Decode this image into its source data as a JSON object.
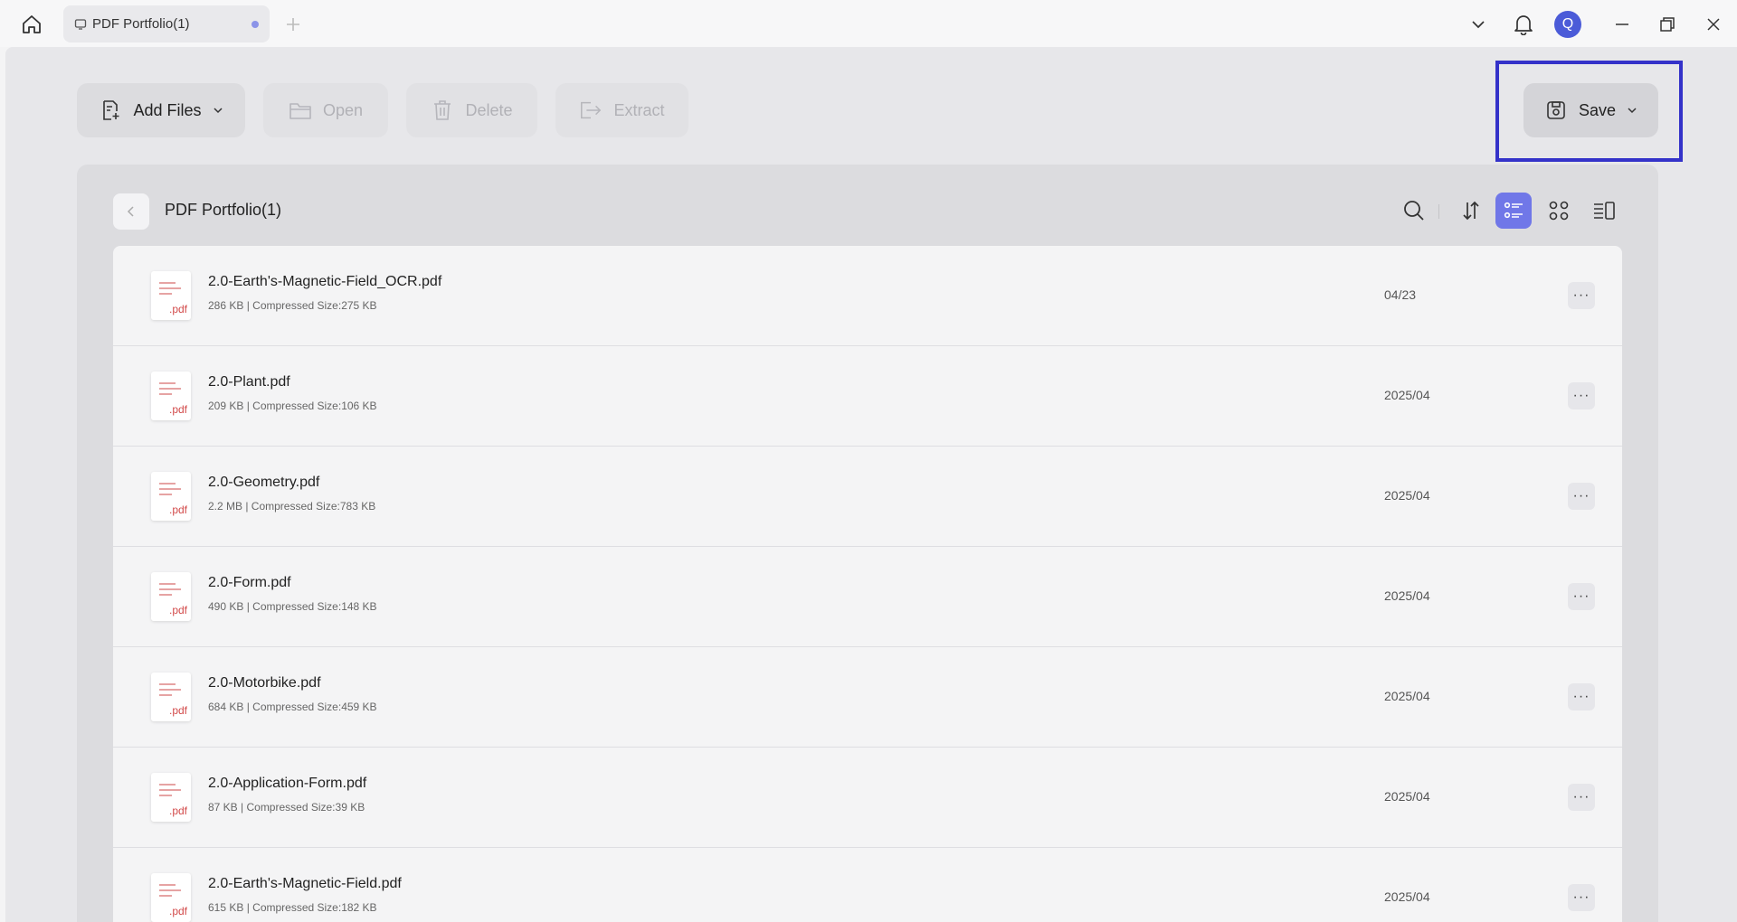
{
  "titlebar": {
    "tab_label": "PDF Portfolio(1)",
    "avatar_letter": "Q"
  },
  "toolbar": {
    "add_files_label": "Add Files",
    "open_label": "Open",
    "delete_label": "Delete",
    "extract_label": "Extract",
    "save_label": "Save"
  },
  "panel": {
    "title": "PDF Portfolio(1)"
  },
  "files": [
    {
      "name": "2.0-Earth's-Magnetic-Field_OCR.pdf",
      "meta": "286 KB | Compressed Size:275 KB",
      "date": "04/23",
      "ext": ".pdf"
    },
    {
      "name": "2.0-Plant.pdf",
      "meta": "209 KB | Compressed Size:106 KB",
      "date": "2025/04",
      "ext": ".pdf"
    },
    {
      "name": "2.0-Geometry.pdf",
      "meta": "2.2 MB | Compressed Size:783 KB",
      "date": "2025/04",
      "ext": ".pdf"
    },
    {
      "name": "2.0-Form.pdf",
      "meta": "490 KB | Compressed Size:148 KB",
      "date": "2025/04",
      "ext": ".pdf"
    },
    {
      "name": "2.0-Motorbike.pdf",
      "meta": "684 KB | Compressed Size:459 KB",
      "date": "2025/04",
      "ext": ".pdf"
    },
    {
      "name": "2.0-Application-Form.pdf",
      "meta": "87 KB | Compressed Size:39 KB",
      "date": "2025/04",
      "ext": ".pdf"
    },
    {
      "name": "2.0-Earth's-Magnetic-Field.pdf",
      "meta": "615 KB | Compressed Size:182 KB",
      "date": "2025/04",
      "ext": ".pdf"
    }
  ],
  "colors": {
    "accent": "#7077e8",
    "highlight_box": "#3432c9",
    "pdf_red": "#d24a4a"
  }
}
